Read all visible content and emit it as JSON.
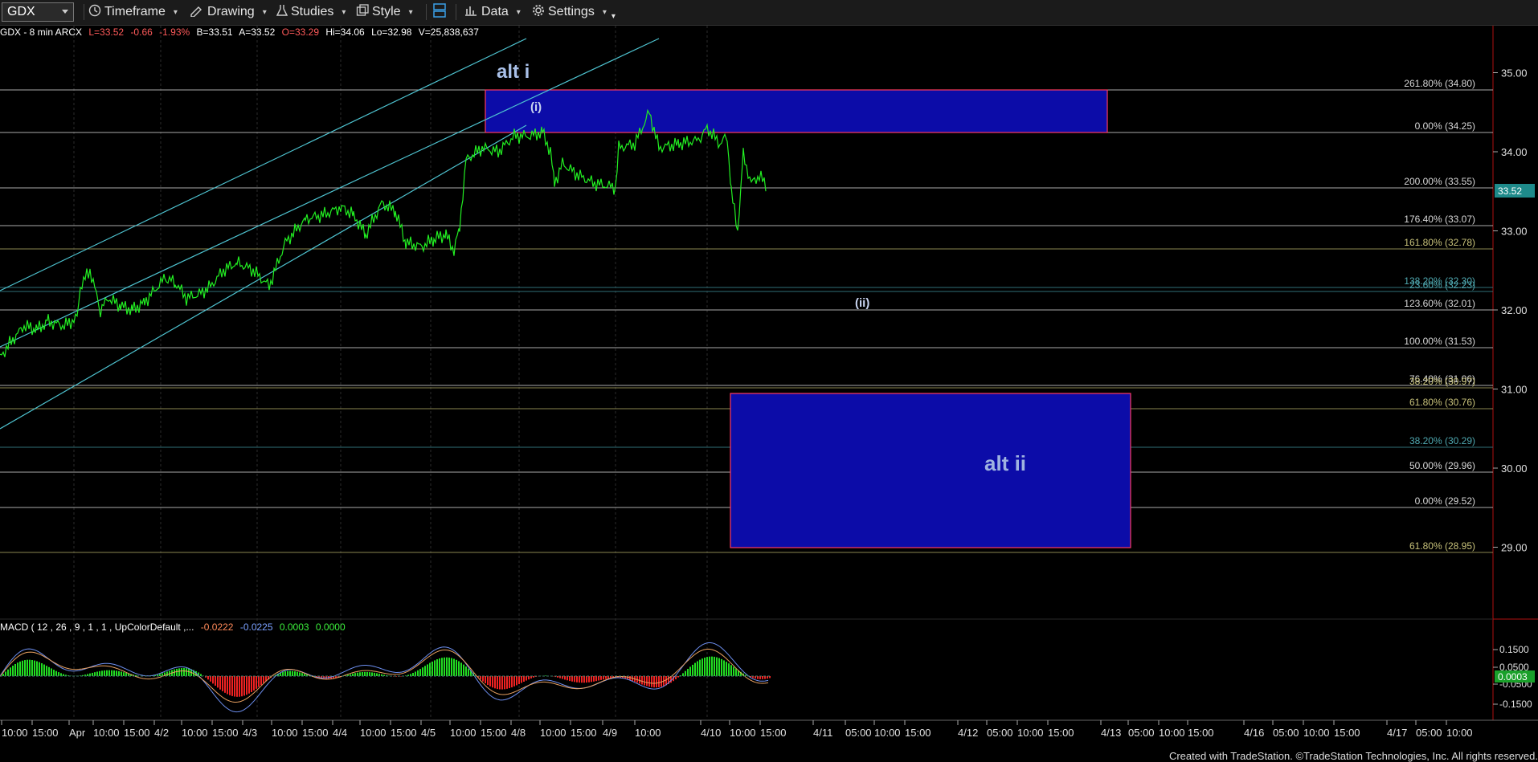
{
  "toolbar": {
    "symbol": "GDX",
    "timeframe_label": "Timeframe",
    "drawing_label": "Drawing",
    "studies_label": "Studies",
    "style_label": "Style",
    "data_label": "Data",
    "settings_label": "Settings"
  },
  "header": {
    "symbol_info": "GDX - 8 min  ARCX",
    "last": "L=33.52",
    "change": "-0.66",
    "change_pct": "-1.93%",
    "bid": "B=33.51",
    "ask": "A=33.52",
    "open": "O=33.29",
    "high": "Hi=34.06",
    "low": "Lo=32.98",
    "volume": "V=25,838,637"
  },
  "price_axis": {
    "ticks": [
      "35.00",
      "34.00",
      "33.00",
      "32.00",
      "31.00",
      "30.00",
      "29.00"
    ],
    "last_price": "33.52"
  },
  "fib_labels": [
    {
      "text": "261.80% (34.80)",
      "color": "#d8d8d8"
    },
    {
      "text": "0.00% (34.25)",
      "color": "#d8d8d8"
    },
    {
      "text": "200.00% (33.55)",
      "color": "#d8d8d8"
    },
    {
      "text": "176.40% (33.07)",
      "color": "#d8d8d8"
    },
    {
      "text": "161.80% (32.78)",
      "color": "#c8c27a"
    },
    {
      "text": "138.20% (32.30)",
      "color": "#4fa8b0"
    },
    {
      "text": "23.60% (32.23)",
      "color": "#4fa8b0"
    },
    {
      "text": "123.60% (32.01)",
      "color": "#d8d8d8"
    },
    {
      "text": "100.00% (31.53)",
      "color": "#d8d8d8"
    },
    {
      "text": "76.40% (31.06)",
      "color": "#d8d8d8"
    },
    {
      "text": "38.20% (30.97)",
      "color": "#c8c27a"
    },
    {
      "text": "61.80% (30.76)",
      "color": "#c8c27a"
    },
    {
      "text": "38.20% (30.29)",
      "color": "#4fa8b0"
    },
    {
      "text": "50.00% (29.96)",
      "color": "#d8d8d8"
    },
    {
      "text": "0.00% (29.52)",
      "color": "#d8d8d8"
    },
    {
      "text": "61.80% (28.95)",
      "color": "#c8c27a"
    }
  ],
  "annotations": {
    "alt_i": "alt i",
    "wave_i": "(i)",
    "wave_ii": "(ii)",
    "alt_ii": "alt ii"
  },
  "macd": {
    "label": "MACD ( 12 , 26 , 9 , 1 , 1 , UpColorDefault ,...",
    "v1": "-0.0222",
    "v2": "-0.0225",
    "v3": "0.0003",
    "v4": "0.0000",
    "axis_ticks": [
      "0.1500",
      "0.0500",
      "-0.0500",
      "-0.1500"
    ],
    "last_value": "0.0003"
  },
  "time_axis": {
    "labels": [
      "10:00",
      "15:00",
      "Apr",
      "10:00",
      "15:00",
      "4/2",
      "10:00",
      "15:00",
      "4/3",
      "10:00",
      "15:00",
      "4/4",
      "10:00",
      "15:00",
      "4/5",
      "10:00",
      "15:00",
      "4/8",
      "10:00",
      "15:00",
      "4/9",
      "10:00",
      "4/10",
      "10:00",
      "15:00",
      "4/11",
      "05:00",
      "10:00",
      "15:00",
      "4/12",
      "05:00",
      "10:00",
      "15:00",
      "4/13",
      "05:00",
      "10:00",
      "15:00",
      "4/16",
      "05:00",
      "10:00",
      "15:00",
      "4/17",
      "05:00",
      "10:00"
    ]
  },
  "footer": "Created with TradeStation. ©TradeStation Technologies, Inc. All rights reserved.",
  "colors": {
    "price_line": "#22ee22",
    "box_fill": "#0c0ca8",
    "box_border": "#ff3a60",
    "channel": "#4ec3d0",
    "macd_up": "#22dd22",
    "macd_down": "#ee2222",
    "macd_line1": "#6d8ff0",
    "macd_line2": "#e8a060"
  }
}
